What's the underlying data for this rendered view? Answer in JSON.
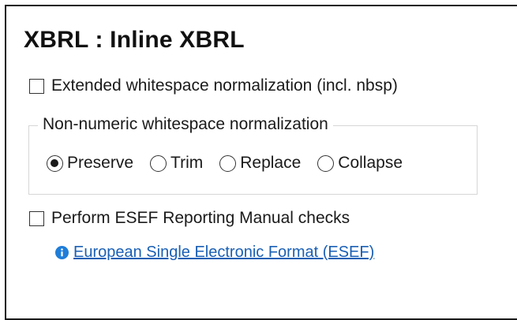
{
  "section": {
    "title": "XBRL : Inline XBRL"
  },
  "options": {
    "extended_whitespace": {
      "label": "Extended whitespace normalization (incl. nbsp)",
      "checked": false
    },
    "non_numeric_group": {
      "legend": "Non-numeric whitespace normalization",
      "radios": [
        {
          "label": "Preserve",
          "checked": true
        },
        {
          "label": "Trim",
          "checked": false
        },
        {
          "label": "Replace",
          "checked": false
        },
        {
          "label": "Collapse",
          "checked": false
        }
      ]
    },
    "esef_checks": {
      "label": "Perform ESEF Reporting Manual checks",
      "checked": false
    }
  },
  "help_link": {
    "icon": "info-icon",
    "text": "European Single Electronic Format (ESEF)"
  },
  "colors": {
    "link": "#1a5fb4",
    "info_icon": "#1f7dd8",
    "group_border": "#d6d6d6"
  }
}
